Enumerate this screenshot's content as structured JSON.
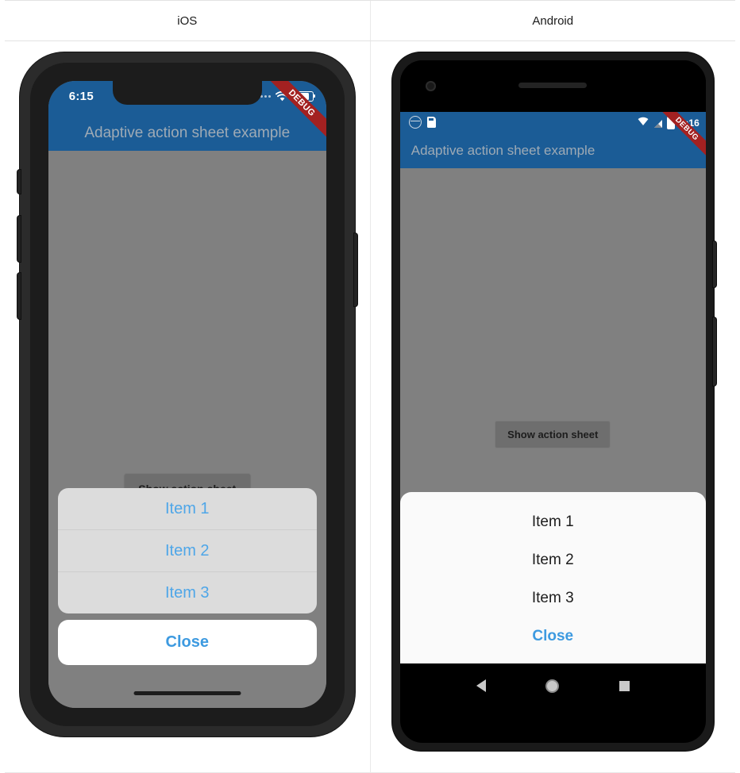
{
  "table": {
    "columns": [
      {
        "header": "iOS"
      },
      {
        "header": "Android"
      }
    ]
  },
  "ios": {
    "status": {
      "time": "6:15",
      "signal_icon": "signal-dots-icon",
      "wifi_icon": "wifi-icon",
      "battery_icon": "battery-icon"
    },
    "debug_banner": "DEBUG",
    "appbar": {
      "title": "Adaptive action sheet example"
    },
    "cta": {
      "label": "Show action sheet"
    },
    "action_sheet": {
      "items": [
        {
          "label": "Item 1"
        },
        {
          "label": "Item 2"
        },
        {
          "label": "Item 3"
        }
      ],
      "close_label": "Close"
    },
    "home_indicator": "home-indicator",
    "hardware": {
      "silent_switch": "silent-switch",
      "volume_up": "volume-up-button",
      "volume_down": "volume-down-button",
      "power": "power-button"
    },
    "colors": {
      "appbar": "#1b5c96",
      "scrim": "#808080",
      "sheet_group": "#dcdcdc",
      "item_text": "#4ea6e8",
      "close_text": "#3d9ae0",
      "debug": "#a32121"
    }
  },
  "android": {
    "status": {
      "time": "6:16",
      "left_icons": [
        {
          "name": "globe-icon"
        },
        {
          "name": "sd-card-icon"
        }
      ],
      "wifi_icon": "wifi-icon",
      "cell_icon": "cell-signal-icon",
      "battery_icon": "battery-icon"
    },
    "debug_banner": "DEBUG",
    "appbar": {
      "title": "Adaptive action sheet example"
    },
    "cta": {
      "label": "Show action sheet"
    },
    "action_sheet": {
      "items": [
        {
          "label": "Item 1"
        },
        {
          "label": "Item 2"
        },
        {
          "label": "Item 3"
        }
      ],
      "close_label": "Close"
    },
    "navbar": {
      "back": "back-button",
      "home": "home-button",
      "recents": "recents-button"
    },
    "hardware": {
      "power": "power-button",
      "volume": "volume-button",
      "camera": "front-camera",
      "earpiece": "earpiece-speaker"
    },
    "colors": {
      "appbar": "#1b5c96",
      "scrim": "#808080",
      "sheet": "#fafafa",
      "item_text": "#1d1d1d",
      "close_text": "#3d9ae0",
      "debug": "#a32121"
    }
  }
}
